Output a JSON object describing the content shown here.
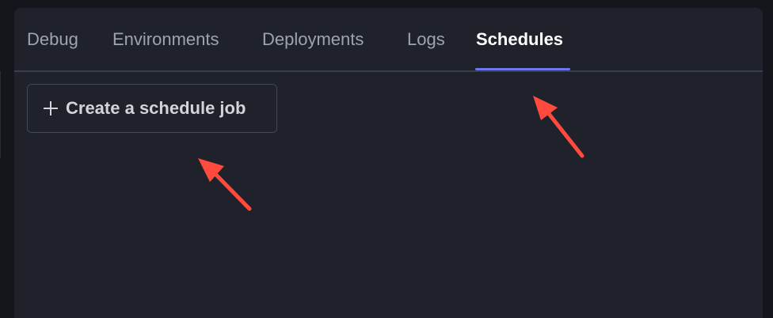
{
  "tabs": [
    {
      "label": "Debug",
      "active": false
    },
    {
      "label": "Environments",
      "active": false
    },
    {
      "label": "Deployments",
      "active": false
    },
    {
      "label": "Logs",
      "active": false
    },
    {
      "label": "Schedules",
      "active": true
    }
  ],
  "create_button": {
    "label": "Create a schedule job",
    "icon": "plus-icon"
  },
  "colors": {
    "background": "#15161b",
    "panel": "#1f222a",
    "accent": "#6f76f2",
    "annotation": "#ff4a3d"
  }
}
